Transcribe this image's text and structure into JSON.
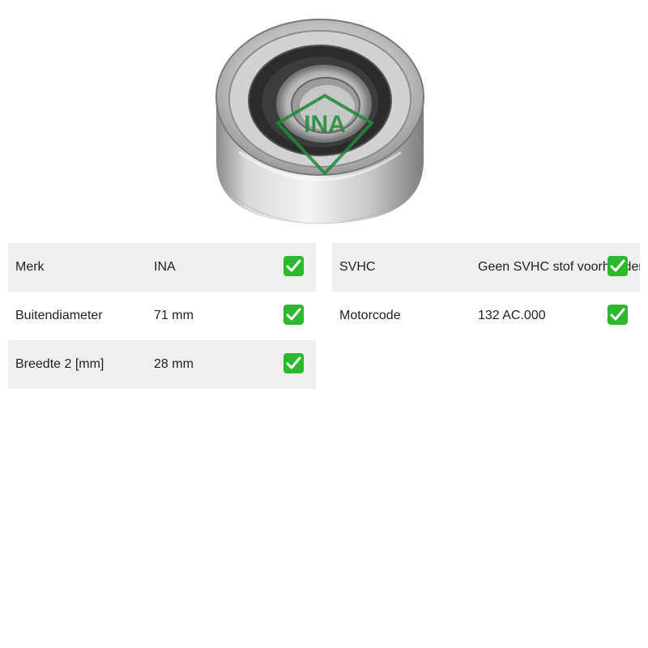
{
  "product": {
    "image_alt": "INA idler pulley",
    "logo_text": "INA",
    "colors": {
      "logo_green": "#1f8a3b",
      "check_green": "#2eb82e",
      "row_shade": "#efefef"
    }
  },
  "specs_left": [
    {
      "label": "Merk",
      "value": "INA",
      "status_icon": "check-mark-icon"
    },
    {
      "label": "Buitendiameter",
      "value": "71 mm",
      "status_icon": "check-mark-icon"
    },
    {
      "label": "Breedte 2 [mm]",
      "value": "28 mm",
      "status_icon": "check-mark-icon"
    }
  ],
  "specs_right": [
    {
      "label": "SVHC",
      "value": "Geen SVHC stof voorhanden",
      "status_icon": "check-mark-icon"
    },
    {
      "label": "Motorcode",
      "value": "132 AC.000",
      "status_icon": "check-mark-icon"
    }
  ]
}
